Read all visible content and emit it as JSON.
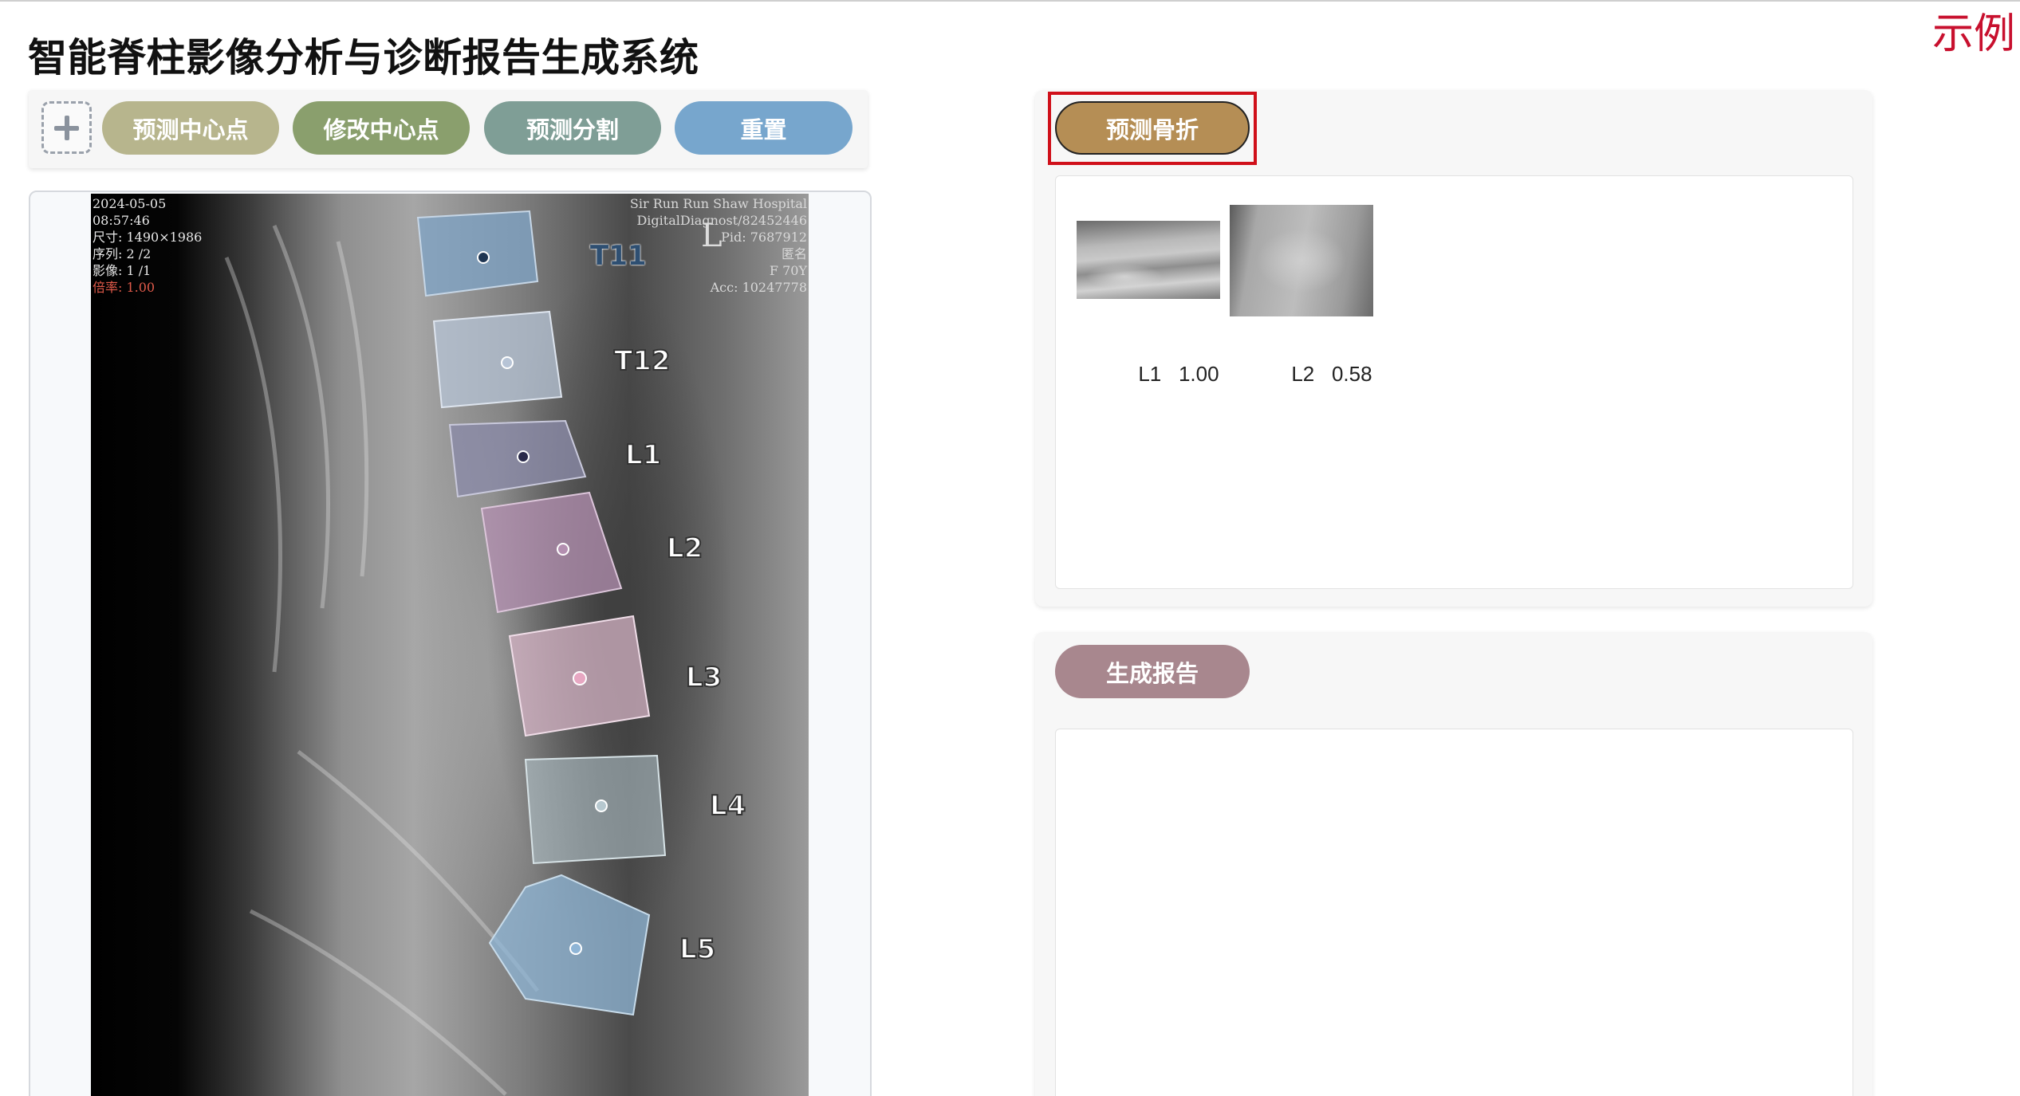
{
  "app": {
    "title": "智能脊柱影像分析与诊断报告生成系统",
    "example_label": "示例"
  },
  "toolbar": {
    "add_icon": "plus-icon",
    "predict_center_label": "预测中心点",
    "edit_center_label": "修改中心点",
    "predict_segmentation_label": "预测分割",
    "reset_label": "重置"
  },
  "image_overlay": {
    "date": "2024-05-05",
    "time": "08:57:46",
    "size": "尺寸: 1490×1986",
    "series": "序列: 2 /2",
    "image": "影像: 1 /1",
    "zoom": "倍率: 1.00",
    "hospital": "Sir Run Run Shaw Hospital",
    "device": "DigitalDiagnost/82452446",
    "pid": "Pid: 7687912",
    "name": "匿名",
    "sex_age": "F 70Y",
    "acc": "Acc: 10247778",
    "side_marker": "L"
  },
  "vertebrae": [
    {
      "label": "T11",
      "color": "#7fa3c4"
    },
    {
      "label": "T12",
      "color": "#b7c4d6"
    },
    {
      "label": "L1",
      "color": "#8a8aa8"
    },
    {
      "label": "L2",
      "color": "#b38fb0"
    },
    {
      "label": "L3",
      "color": "#d8b6c8"
    },
    {
      "label": "L4",
      "color": "#b6c8cf"
    },
    {
      "label": "L5",
      "color": "#8fb5d6"
    }
  ],
  "fracture": {
    "button_label": "预测骨折",
    "results": [
      {
        "vertebra": "L1",
        "score": "1.00"
      },
      {
        "vertebra": "L2",
        "score": "0.58"
      }
    ]
  },
  "report": {
    "button_label": "生成报告"
  }
}
